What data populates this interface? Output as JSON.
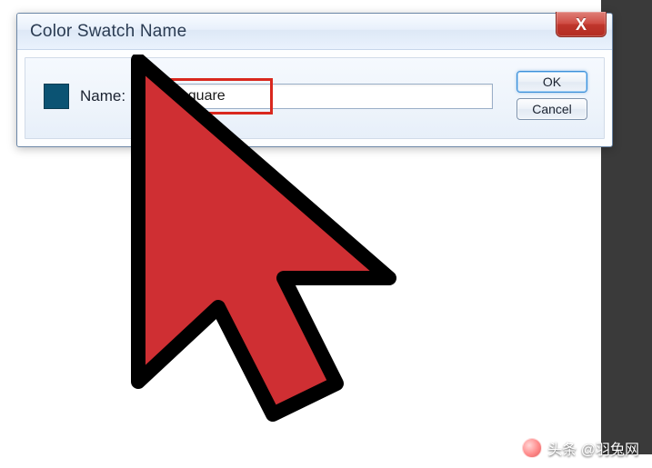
{
  "dialog": {
    "title": "Color Swatch Name",
    "name_label": "Name:",
    "name_value": "small square",
    "buttons": {
      "ok": "OK",
      "cancel": "Cancel"
    },
    "close_symbol": "X",
    "swatch_color": "#0b5373"
  },
  "watermark": {
    "text": "头条 @羽兔网"
  }
}
